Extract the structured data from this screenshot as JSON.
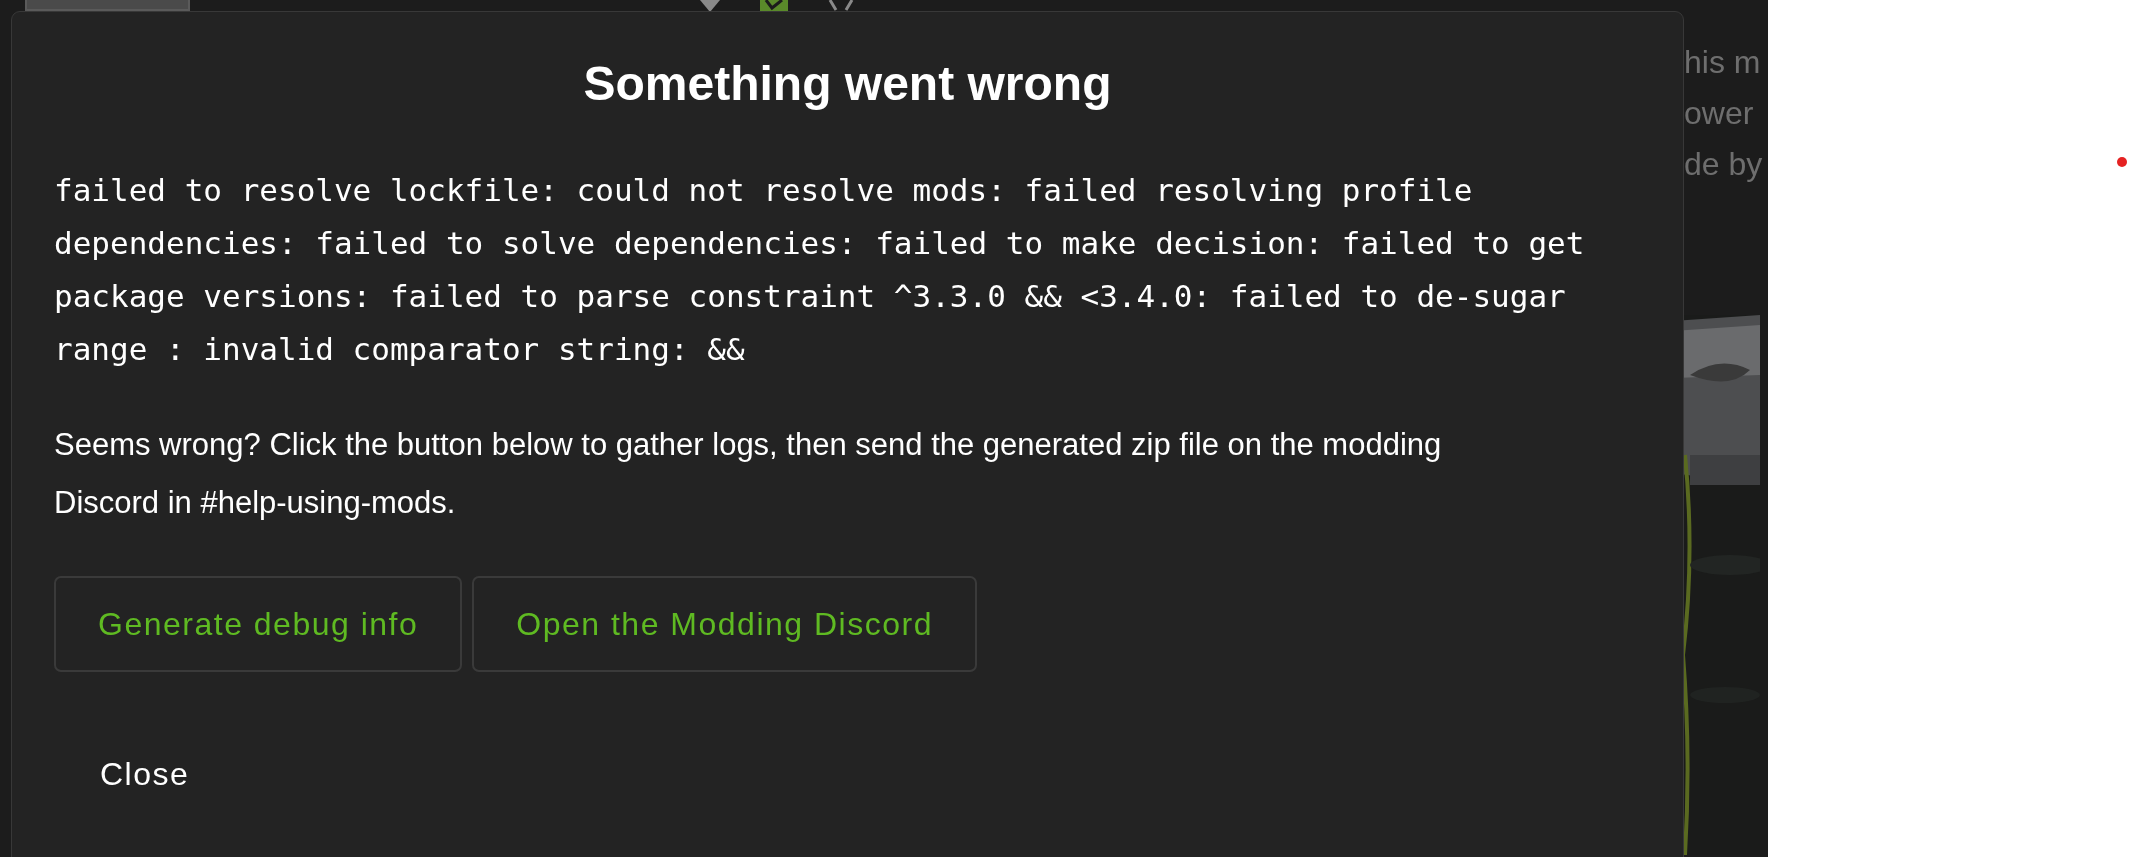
{
  "background": {
    "description_lines": [
      "his m",
      "ower",
      "de by"
    ]
  },
  "dialog": {
    "title": "Something went wrong",
    "error_message": "failed to resolve lockfile: could not resolve mods: failed resolving profile dependencies: failed to solve dependencies: failed to make decision: failed to get package versions: failed to parse constraint ^3.3.0 && <3.4.0: failed to de-sugar range : invalid comparator string: &&",
    "help_text": "Seems wrong? Click the button below to gather logs, then send the generated zip file on the modding Discord in #help-using-mods.",
    "buttons": [
      {
        "label": "Generate debug info",
        "kind": "outlined"
      },
      {
        "label": "Open the Modding Discord",
        "kind": "outlined"
      }
    ],
    "close_button": {
      "label": "Close",
      "kind": "text"
    }
  }
}
